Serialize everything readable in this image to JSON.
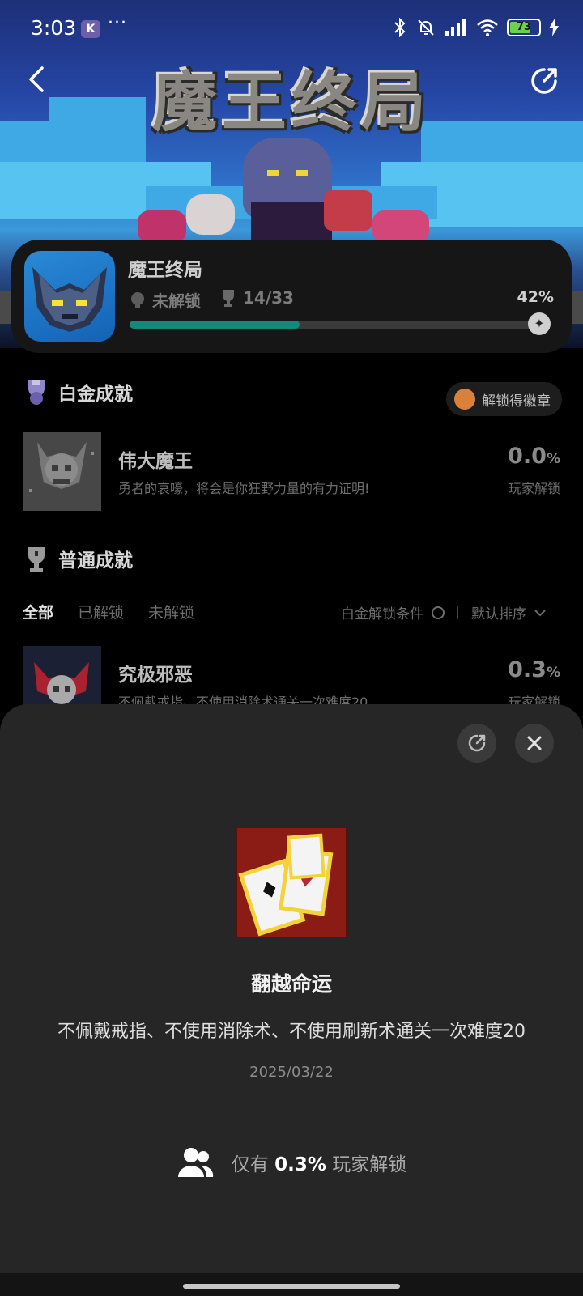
{
  "status_bar": {
    "time": "3:03",
    "app_badge": "K",
    "more": "···",
    "battery": "73"
  },
  "hero": {
    "title": "魔王终局"
  },
  "game": {
    "name": "魔王终局",
    "lock_status": "未解锁",
    "trophies": "14/33",
    "percent_label": "42%",
    "progress": 0.42
  },
  "platinum": {
    "heading": "白金成就",
    "badge_button": "解锁得徽章",
    "item": {
      "title": "伟大魔王",
      "desc": "勇者的哀嚎，将会是你狂野力量的有力证明!",
      "pct": "0.0",
      "pct_unit": "%",
      "pct_label": "玩家解锁"
    }
  },
  "normal": {
    "heading": "普通成就",
    "tabs": [
      "全部",
      "已解锁",
      "未解锁"
    ],
    "filter_label": "白金解锁条件",
    "sort_label": "默认排序",
    "items": [
      {
        "title": "究极邪恶",
        "desc": "不佩戴戒指、不使用消除术通关一次难度20",
        "pct": "0.3",
        "pct_unit": "%",
        "pct_label": "玩家解锁"
      }
    ]
  },
  "sheet": {
    "title": "翻越命运",
    "desc": "不佩戴戒指、不使用消除术、不使用刷新术通关一次难度20",
    "date": "2025/03/22",
    "stat_prefix": "仅有",
    "stat_value": "0.3%",
    "stat_suffix": "玩家解锁"
  },
  "colors": {
    "progress": "#138a79",
    "sheet_bg": "#262626",
    "card_bg": "#161616"
  }
}
